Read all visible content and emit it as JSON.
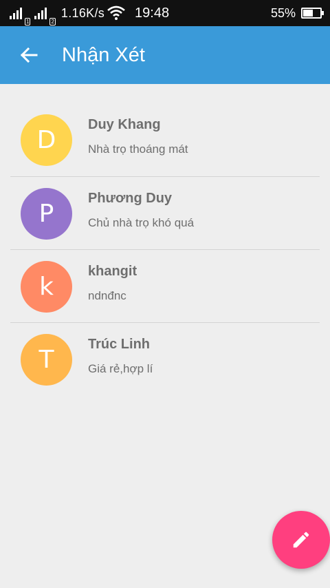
{
  "status_bar": {
    "speed": "1.16K/s",
    "time": "19:48",
    "battery": "55%",
    "battery_level": 0.55,
    "sim1": "1",
    "sim2": "2"
  },
  "app_bar": {
    "title": "Nhận Xét",
    "back_icon": "arrow-left-icon"
  },
  "reviews": [
    {
      "initial": "D",
      "name": "Duy Khang",
      "comment": "Nhà trọ thoáng mát",
      "color": "#ffd54f"
    },
    {
      "initial": "P",
      "name": "Phương Duy",
      "comment": "Chủ nhà trọ khó quá",
      "color": "#9575cd"
    },
    {
      "initial": "k",
      "name": "khangit",
      "comment": "ndnđnc",
      "color": "#ff8a65"
    },
    {
      "initial": "T",
      "name": "Trúc Linh",
      "comment": "Giá rẻ,hợp lí",
      "color": "#ffb74d"
    }
  ],
  "fab": {
    "icon": "pencil-icon",
    "color": "#ff3f7f"
  },
  "colors": {
    "app_bar": "#3a9ad9",
    "background": "#eeeeee",
    "status_bar": "#111111"
  }
}
